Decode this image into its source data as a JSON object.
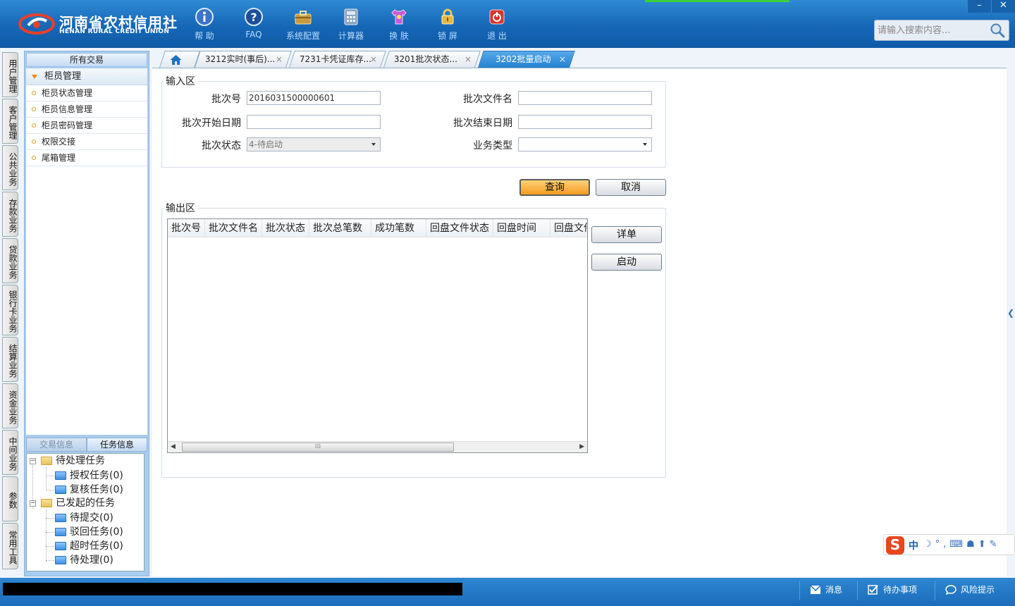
{
  "header": {
    "logo_cn": "河南省农村信用社",
    "logo_en": "HENAN RURAL CREDIT UNION",
    "toolbar": [
      {
        "label": "帮 助",
        "icon": "info-icon"
      },
      {
        "label": "FAQ",
        "icon": "help-icon"
      },
      {
        "label": "系统配置",
        "icon": "toolbox-icon"
      },
      {
        "label": "计算器",
        "icon": "calculator-icon"
      },
      {
        "label": "换 肤",
        "icon": "shirt-icon"
      },
      {
        "label": "锁 屏",
        "icon": "lock-icon"
      },
      {
        "label": "退 出",
        "icon": "power-icon"
      }
    ],
    "window": {
      "minimize": "–",
      "close": "✕"
    },
    "search_placeholder": "请输入搜索内容..."
  },
  "vnav": [
    "用户管理",
    "客户管理",
    "公共业务",
    "存款业务",
    "贷款业务",
    "银行卡业务",
    "结算业务",
    "资金业务",
    "中间业务",
    "参数",
    "常用工具"
  ],
  "sidebar": {
    "header": "所有交易",
    "group": "柜员管理",
    "items": [
      "柜员状态管理",
      "柜员信息管理",
      "柜员密码管理",
      "权限交接",
      "尾箱管理"
    ],
    "subtabs": [
      "交易信息",
      "任务信息"
    ],
    "tree": {
      "pending": "待处理任务",
      "pending_children": [
        "授权任务(0)",
        "复核任务(0)"
      ],
      "initiated": "已发起的任务",
      "initiated_children": [
        "待提交(0)",
        "驳回任务(0)",
        "超时任务(0)",
        "待处理(0)"
      ]
    }
  },
  "tabs": [
    {
      "label": "3212实时(事后)..."
    },
    {
      "label": "7231卡凭证库存..."
    },
    {
      "label": "3201批次状态..."
    },
    {
      "label": "3202批量启动",
      "active": true
    }
  ],
  "tab_close": "×",
  "input_area": {
    "legend": "输入区",
    "batch_no_label": "批次号",
    "batch_no_value": "2016031500000601",
    "batch_file_label": "批次文件名",
    "batch_file_value": "",
    "start_date_label": "批次开始日期",
    "start_date_value": "",
    "end_date_label": "批次结束日期",
    "end_date_value": "",
    "status_label": "批次状态",
    "status_value": "4-待启动",
    "biz_type_label": "业务类型",
    "biz_type_value": ""
  },
  "buttons": {
    "query": "查询",
    "cancel": "取消",
    "detail": "详单",
    "start": "启动"
  },
  "output_area": {
    "legend": "输出区",
    "columns": [
      "批次号",
      "批次文件名",
      "批次状态",
      "批次总笔数",
      "成功笔数",
      "回盘文件状态",
      "回盘时间",
      "回盘文件"
    ],
    "rows": [],
    "scroll_grip": "⁞⁞⁞"
  },
  "ime": {
    "logo": "S",
    "mode": "中",
    "icons": "☽°,⌨☗⬆✎"
  },
  "statusbar": {
    "messages": "消息",
    "todo": "待办事项",
    "risk": "风险提示"
  },
  "colors": {
    "header_blue": "#1667b7",
    "accent_orange": "#f39b1f",
    "active_tab": "#2582d0"
  }
}
